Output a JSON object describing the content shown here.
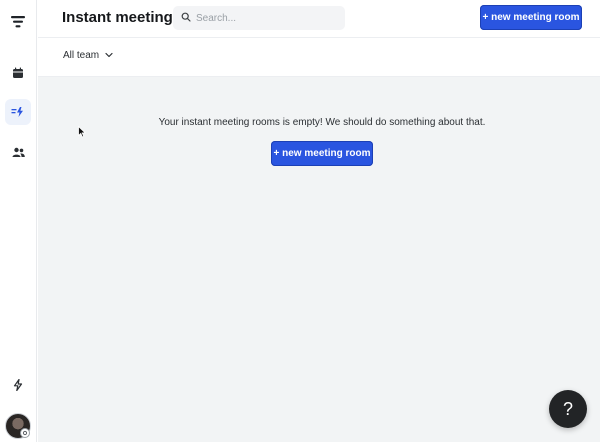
{
  "header": {
    "title": "Instant meetings",
    "search_placeholder": "Search...",
    "new_room_label": "+ new meeting room"
  },
  "filter": {
    "team_selected": "All team"
  },
  "empty_state": {
    "message": "Your instant meeting rooms is empty! We should do something about that.",
    "button_label": "+ new meeting room"
  },
  "help": {
    "label": "?"
  },
  "sidebar": {
    "items": [
      {
        "icon": "menu-filter-icon"
      },
      {
        "icon": "calendar-icon"
      },
      {
        "icon": "instant-meeting-icon",
        "active": true
      },
      {
        "icon": "users-icon"
      },
      {
        "icon": "lightning-icon"
      }
    ]
  },
  "colors": {
    "primary": "#2a55e0",
    "content_bg": "#f2f4f5",
    "active_nav_bg": "#edf2fb",
    "help_bg": "#222426"
  }
}
